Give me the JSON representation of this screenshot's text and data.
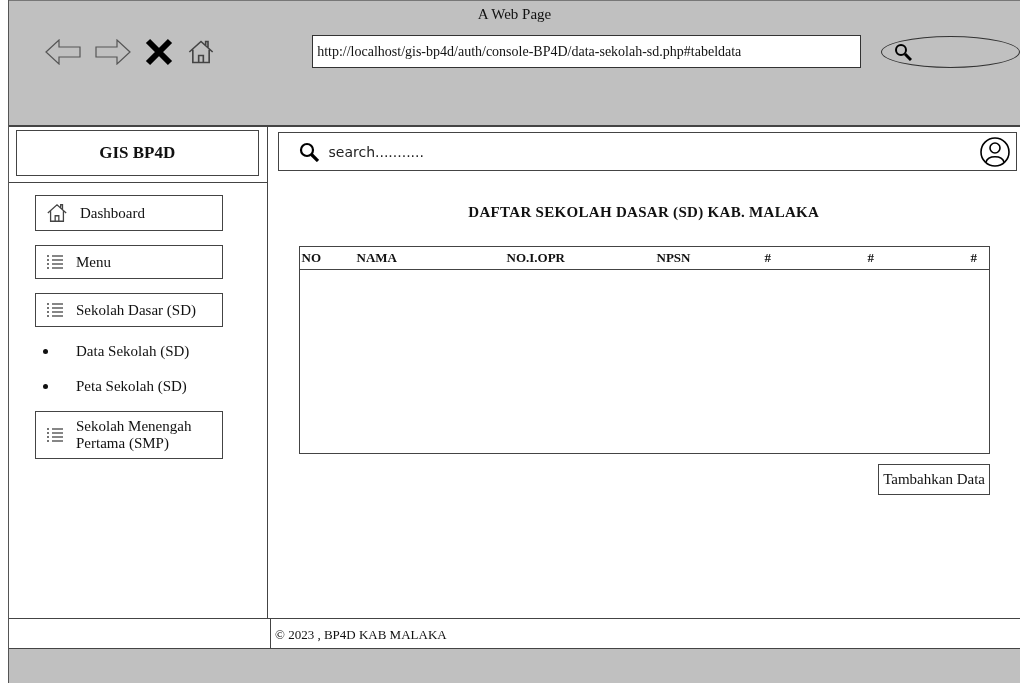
{
  "window": {
    "title": "A Web Page"
  },
  "browser": {
    "url": "http://localhost/gis-bp4d/auth/console-BP4D/data-sekolah-sd.php#tabeldata"
  },
  "sidebar": {
    "brand": "GIS BP4D",
    "items": [
      {
        "kind": "home",
        "label": "Dashboard"
      },
      {
        "kind": "list",
        "label": "Menu"
      },
      {
        "kind": "list",
        "label": "Sekolah Dasar (SD)"
      },
      {
        "kind": "bullet",
        "label": "Data Sekolah (SD)"
      },
      {
        "kind": "bullet",
        "label": "Peta Sekolah (SD)"
      },
      {
        "kind": "list",
        "label": "Sekolah Menengah Pertama (SMP)"
      }
    ]
  },
  "topbar": {
    "search_placeholder": "search..........."
  },
  "content": {
    "heading": "DAFTAR SEKOLAH DASAR (SD) KAB. MALAKA",
    "table": {
      "columns": [
        "NO",
        "NAMA",
        "NO.I.OPR",
        "NPSN",
        "#",
        "#",
        "#"
      ]
    },
    "add_button": "Tambahkan Data"
  },
  "footer": {
    "text": "© 2023 , BP4D KAB MALAKA"
  }
}
